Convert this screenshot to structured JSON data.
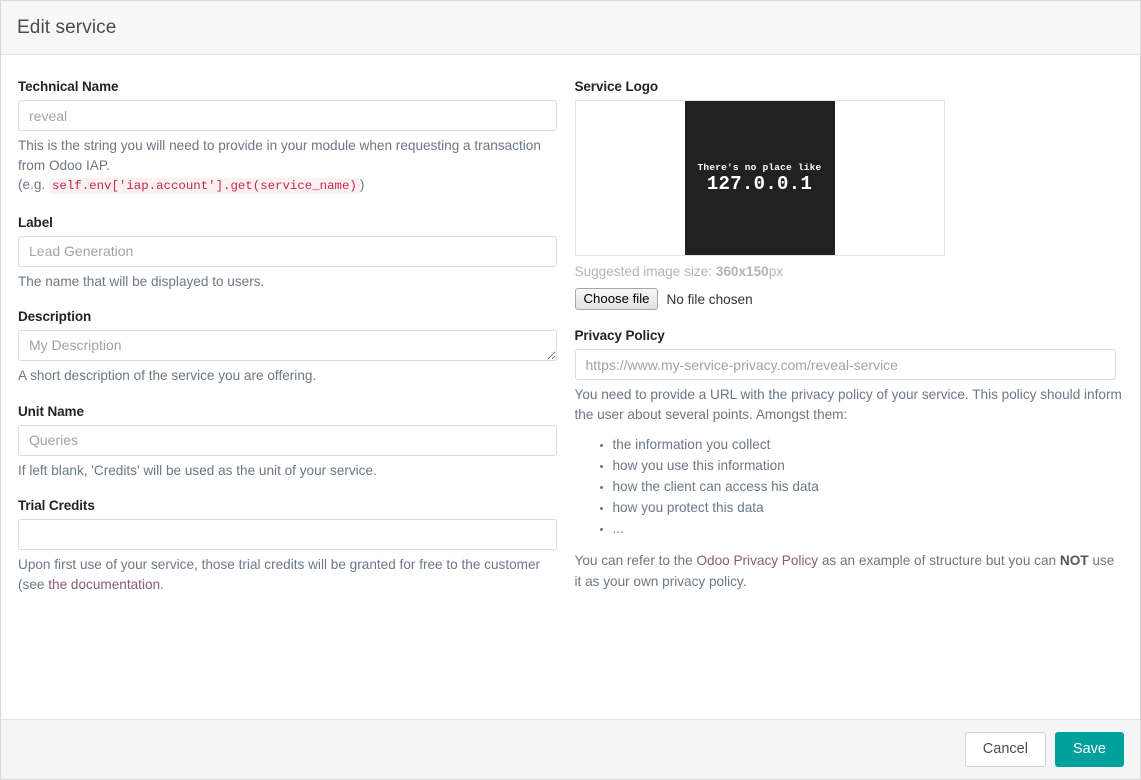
{
  "dialog": {
    "title": "Edit service",
    "accent_color": "#00a09d",
    "link_color": "#875a7b"
  },
  "left": {
    "technical_name": {
      "label": "Technical Name",
      "placeholder": "reveal",
      "value": "",
      "help_before": "This is the string you will need to provide in your module when requesting a transaction from Odoo IAP.",
      "example_prefix": "(e.g.",
      "example_code": "self.env['iap.account'].get(service_name)",
      "example_suffix": ")"
    },
    "label_field": {
      "label": "Label",
      "placeholder": "Lead Generation",
      "value": "",
      "help": "The name that will be displayed to users."
    },
    "description": {
      "label": "Description",
      "placeholder": "My Description",
      "value": "",
      "help": "A short description of the service you are offering."
    },
    "unit_name": {
      "label": "Unit Name",
      "placeholder": "Queries",
      "value": "",
      "help": "If left blank, 'Credits' will be used as the unit of your service."
    },
    "trial_credits": {
      "label": "Trial Credits",
      "placeholder": "",
      "value": "",
      "help_before": "Upon first use of your service, those trial credits will be granted for free to the customer (see ",
      "help_link": "the documentation",
      "help_after": "."
    }
  },
  "right": {
    "service_logo": {
      "label": "Service Logo",
      "image_line1": "There's no place like",
      "image_line2": "127.0.0.1",
      "suggested_prefix": "Suggested image size: ",
      "suggested_size": "360x150",
      "suggested_suffix": "px",
      "choose_file_button": "Choose file",
      "file_status": "No file chosen"
    },
    "privacy_policy": {
      "label": "Privacy Policy",
      "placeholder": "https://www.my-service-privacy.com/reveal-service",
      "value": "",
      "intro": "You need to provide a URL with the privacy policy of your service. This policy should inform the user about several points. Amongst them:",
      "points": [
        "the information you collect",
        "how you use this information",
        "how the client can access his data",
        "how you protect this data",
        "..."
      ],
      "outro_before": "You can refer to the ",
      "outro_link": "Odoo Privacy Policy",
      "outro_middle": " as an example of structure but you can ",
      "outro_bold": "NOT",
      "outro_after": " use it as your own privacy policy."
    }
  },
  "footer": {
    "cancel_label": "Cancel",
    "save_label": "Save"
  }
}
